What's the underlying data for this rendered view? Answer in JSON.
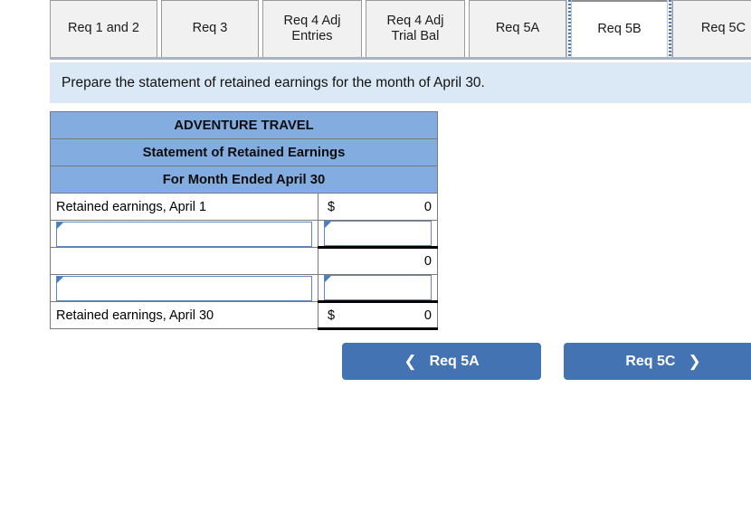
{
  "tabs": [
    {
      "label": "Req 1 and 2",
      "active": false,
      "width": 119
    },
    {
      "label": "Req 3",
      "active": false,
      "width": 108
    },
    {
      "label": "Req 4 Adj\nEntries",
      "active": false,
      "width": 110
    },
    {
      "label": "Req 4 Adj\nTrial Bal",
      "active": false,
      "width": 110
    },
    {
      "label": "Req 5A",
      "active": false,
      "width": 108
    },
    {
      "label": "Req 5B",
      "active": true,
      "width": 105
    },
    {
      "label": "Req 5C",
      "active": false,
      "width": 113
    }
  ],
  "banner": {
    "instruction": "Prepare the statement of retained earnings for the month of April 30."
  },
  "statement": {
    "title": "ADVENTURE TRAVEL",
    "subtitle": "Statement of Retained Earnings",
    "period": "For Month Ended April 30",
    "rows": [
      {
        "type": "static",
        "label": "Retained earnings, April 1",
        "currency": "$",
        "amount": "0",
        "ruled": false
      },
      {
        "type": "input",
        "label": "",
        "label_placeholder": "",
        "amount": "",
        "amount_placeholder": "",
        "ruled": true
      },
      {
        "type": "static",
        "label": "",
        "currency": "",
        "amount": "0",
        "ruled": false
      },
      {
        "type": "input",
        "label": "",
        "label_placeholder": "",
        "amount": "",
        "amount_placeholder": "",
        "ruled": true
      },
      {
        "type": "static",
        "label": "Retained earnings, April 30",
        "currency": "$",
        "amount": "0",
        "ruled": true
      }
    ]
  },
  "nav": {
    "prev_label": "Req 5A",
    "prev_icon": "chevron-left-icon",
    "next_label": "Req 5C",
    "next_icon": "chevron-right-icon"
  },
  "colors": {
    "header_blue": "#83ace0",
    "banner_blue": "#dbe9f7",
    "button_blue": "#4473b3",
    "tab_gray": "#f1f1f1",
    "grid_gray": "#7a7a7a",
    "input_border_blue": "#5b87c4"
  }
}
